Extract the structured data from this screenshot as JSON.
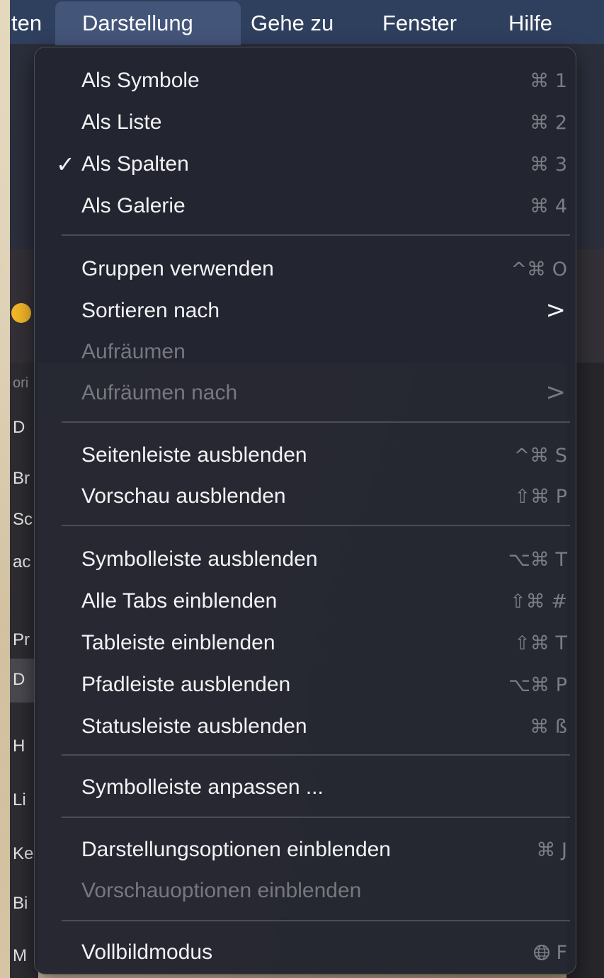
{
  "menubar": {
    "items": [
      "ten",
      "Darstellung",
      "Gehe zu",
      "Fenster",
      "Hilfe"
    ]
  },
  "sidebar": {
    "section_label": "ori",
    "items": [
      "D",
      "Br",
      "Sc",
      "ac",
      "Pr",
      "D",
      "H",
      "Li",
      "Ke",
      "Bi",
      "M"
    ]
  },
  "menu": {
    "items": [
      {
        "label": "Als Symbole",
        "shortcut": "⌘ 1"
      },
      {
        "label": "Als Liste",
        "shortcut": "⌘ 2"
      },
      {
        "label": "Als Spalten",
        "shortcut": "⌘ 3",
        "checked": "✓"
      },
      {
        "label": "Als Galerie",
        "shortcut": "⌘ 4"
      },
      {
        "label": "Gruppen verwenden",
        "shortcut": "^⌘ O"
      },
      {
        "label": "Sortieren nach",
        "submenu": ">"
      },
      {
        "label": "Aufräumen",
        "disabled": true
      },
      {
        "label": "Aufräumen nach",
        "submenu": ">",
        "disabled": true
      },
      {
        "label": "Seitenleiste ausblenden",
        "shortcut": "^⌘ S"
      },
      {
        "label": "Vorschau ausblenden",
        "shortcut": "⇧⌘ P"
      },
      {
        "label": "Symbolleiste ausblenden",
        "shortcut": "⌥⌘ T"
      },
      {
        "label": "Alle Tabs einblenden",
        "shortcut": "⇧⌘ #"
      },
      {
        "label": "Tableiste einblenden",
        "shortcut": "⇧⌘ T"
      },
      {
        "label": "Pfadleiste ausblenden",
        "shortcut": "⌥⌘ P"
      },
      {
        "label": "Statusleiste ausblenden",
        "shortcut": "⌘ ß"
      },
      {
        "label": "Symbolleiste anpassen ..."
      },
      {
        "label": "Darstellungsoptionen einblenden",
        "shortcut": "⌘ J"
      },
      {
        "label": "Vorschauoptionen einblenden",
        "disabled": true
      },
      {
        "label": "Vollbildmodus",
        "shortcut": "F",
        "shortcut_icon": "globe-icon"
      }
    ]
  },
  "colors": {
    "menubar": "#2f3f5e",
    "menu_background": "#242630",
    "accent_dot": "#f4b728"
  }
}
